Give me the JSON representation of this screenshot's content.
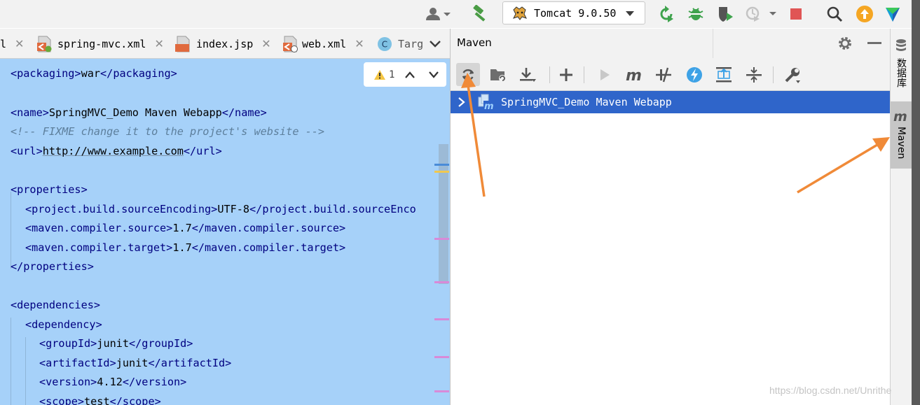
{
  "run_config": {
    "label": "Tomcat 9.0.50"
  },
  "editor_tabs": [
    {
      "label": "l",
      "type": "xml"
    },
    {
      "label": "spring-mvc.xml",
      "type": "xml"
    },
    {
      "label": "index.jsp",
      "type": "jsp",
      "badge": "JSP"
    },
    {
      "label": "web.xml",
      "type": "xml"
    },
    {
      "label": "Targ",
      "type": "class",
      "badge": "C"
    }
  ],
  "inspection": {
    "warnings": "1"
  },
  "code": {
    "l1": {
      "open": "<packaging>",
      "text": "war",
      "close": "</packaging>"
    },
    "l2": {
      "open": "<name>",
      "text": "SpringMVC_Demo Maven Webapp",
      "close": "</name>"
    },
    "l3": {
      "comment": "<!-- FIXME change it to the project's website -->"
    },
    "l4": {
      "open": "<url>",
      "text": "http://www.example.com",
      "close": "</url>"
    },
    "l5": {
      "open": "<properties>"
    },
    "l6": {
      "open": "<project.build.sourceEncoding>",
      "text": "UTF-8",
      "close": "</project.build.sourceEnco"
    },
    "l7": {
      "open": "<maven.compiler.source>",
      "text": "1.7",
      "close": "</maven.compiler.source>"
    },
    "l8": {
      "open": "<maven.compiler.target>",
      "text": "1.7",
      "close": "</maven.compiler.target>"
    },
    "l9": {
      "close": "</properties>"
    },
    "l10": {
      "open": "<dependencies>"
    },
    "l11": {
      "open": "<dependency>"
    },
    "l12": {
      "open": "<groupId>",
      "text": "junit",
      "close": "</groupId>"
    },
    "l13": {
      "open": "<artifactId>",
      "text": "junit",
      "close": "</artifactId>"
    },
    "l14": {
      "open": "<version>",
      "text": "4.12",
      "close": "</version>"
    },
    "l15": {
      "open": "<scope>",
      "text": "test",
      "close": "</scope>"
    }
  },
  "maven": {
    "title": "Maven",
    "project": "SpringMVC_Demo Maven Webapp",
    "toolbar_icons": [
      "reload-all-maven-projects-icon",
      "generate-sources-icon",
      "download-sources-icon",
      "add-maven-projects-icon",
      "run-maven-build-icon",
      "execute-maven-goal-icon",
      "toggle-offline-mode-icon",
      "toggle-skip-tests-icon",
      "show-dependencies-icon",
      "collapse-all-icon",
      "maven-settings-icon"
    ]
  },
  "side_strip": {
    "database": "数据库",
    "maven": "Maven"
  },
  "watermark": "https://blog.csdn.net/Unrithe",
  "colors": {
    "editor_selection": "#a6d1f9",
    "xml_tag": "#000080",
    "tree_selection": "#2f65ca",
    "annotation_arrow": "#f08a38",
    "stop_red": "#e05555",
    "run_green": "#3fa34d"
  }
}
